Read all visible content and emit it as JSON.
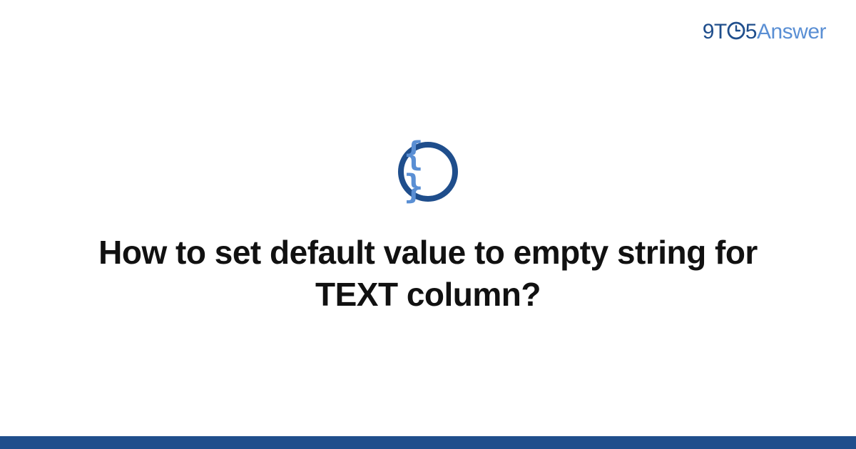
{
  "brand": {
    "part1": "9T",
    "part2": "5",
    "part3": "Answer"
  },
  "center_icon_glyph": "{ }",
  "question_title": "How to set default value to empty string for TEXT column?",
  "colors": {
    "brand_dark": "#1f4e8c",
    "brand_light": "#5a8fd4",
    "text": "#111111",
    "bar": "#1f4e8c"
  }
}
